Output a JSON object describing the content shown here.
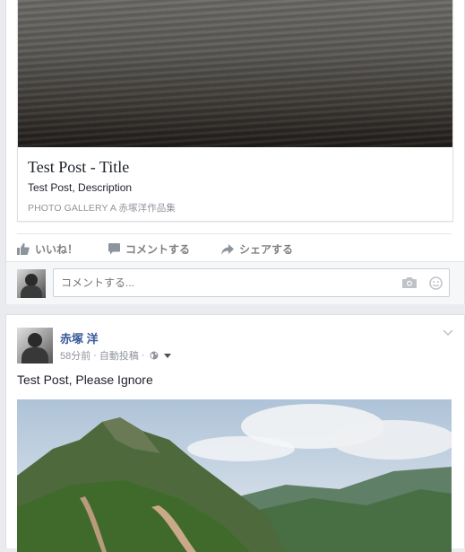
{
  "post1": {
    "link": {
      "title": "Test Post - Title",
      "description": "Test Post, Description",
      "source": "PHOTO GALLERY A 赤塚洋作品集"
    },
    "actions": {
      "like": "いいね！",
      "comment": "コメントする",
      "share": "シェアする"
    },
    "comment_box": {
      "placeholder": "コメントする..."
    }
  },
  "post2": {
    "author": "赤塚 洋",
    "time": "58分前",
    "source": "自動投稿",
    "text": "Test Post, Please Ignore"
  },
  "colors": {
    "link": "#365899",
    "muted": "#90949c",
    "background": "#e9ebee"
  },
  "icons": [
    "like-icon",
    "comment-icon",
    "share-icon",
    "camera-icon",
    "emoji-icon",
    "globe-icon",
    "chevron-down-icon"
  ]
}
